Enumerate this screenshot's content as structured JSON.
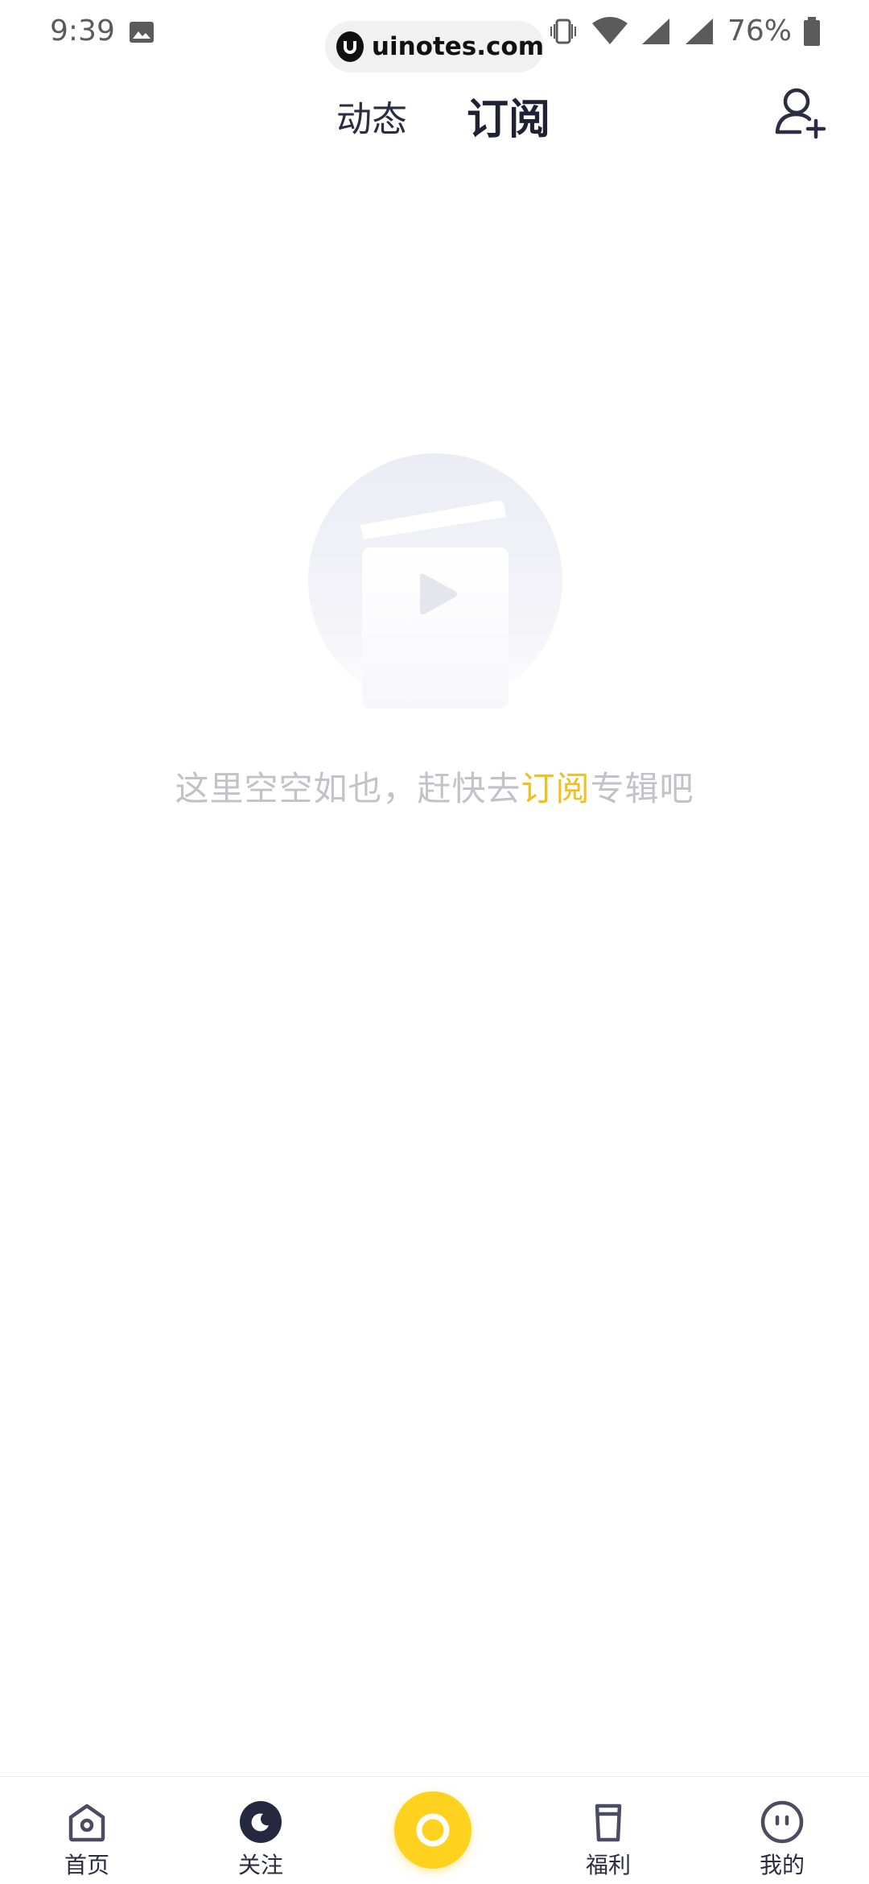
{
  "status_bar": {
    "time": "9:39",
    "watermark": "uinotes.com",
    "battery": "76%"
  },
  "header": {
    "tabs": [
      {
        "label": "动态",
        "active": false
      },
      {
        "label": "订阅",
        "active": true
      }
    ]
  },
  "empty_state": {
    "text_before": "这里空空如也，赶快去",
    "text_highlight": "订阅",
    "text_after": "专辑吧",
    "highlight_color": "#f0c01e"
  },
  "bottom_nav": {
    "items": [
      {
        "label": "首页",
        "icon": "home-icon"
      },
      {
        "label": "关注",
        "icon": "moon-icon",
        "active": true
      },
      {
        "label": "",
        "icon": "play-center-icon"
      },
      {
        "label": "福利",
        "icon": "cup-icon"
      },
      {
        "label": "我的",
        "icon": "face-icon"
      }
    ],
    "accent": "#ffd21f"
  }
}
